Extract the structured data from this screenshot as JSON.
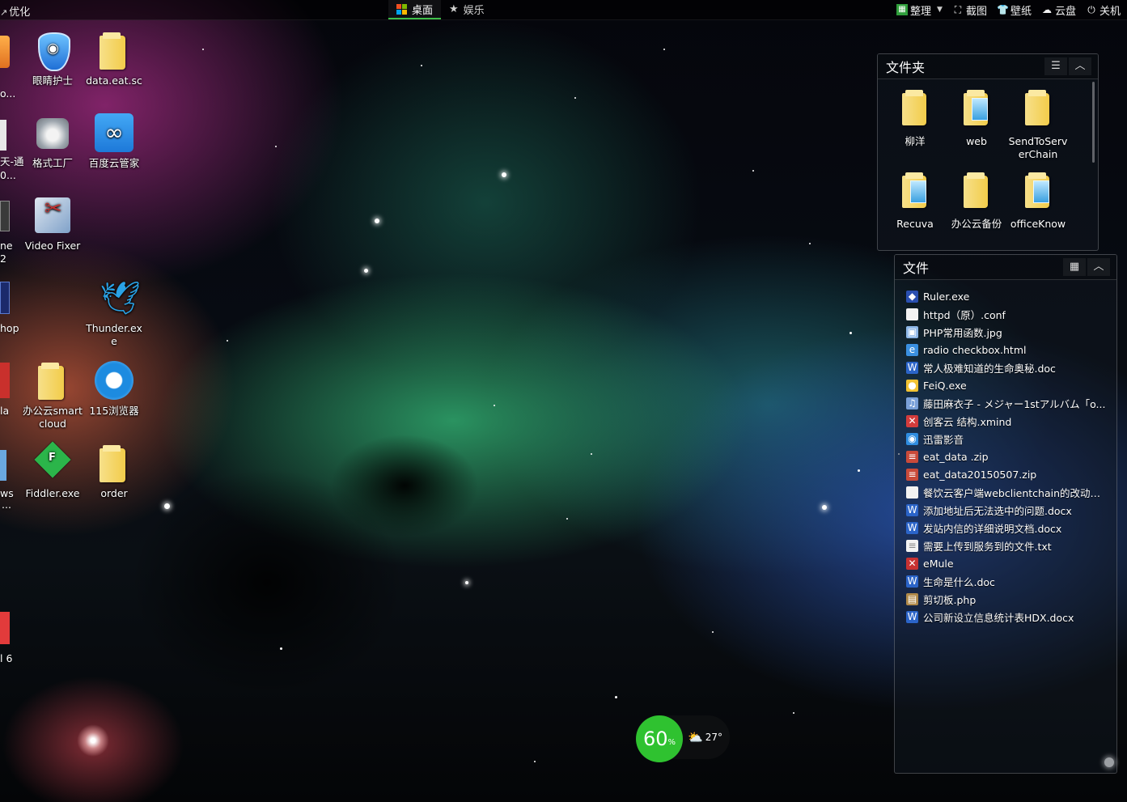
{
  "topbar": {
    "left_label": "优化",
    "tabs": [
      {
        "label": "桌面",
        "active": true,
        "icon": "windows-icon"
      },
      {
        "label": "娱乐",
        "active": false,
        "icon": "star-icon"
      }
    ],
    "tools": [
      {
        "label": "整理",
        "icon": "organize-icon",
        "has_dropdown": true
      },
      {
        "label": "截图",
        "icon": "screenshot-icon"
      },
      {
        "label": "壁纸",
        "icon": "shirt-icon"
      },
      {
        "label": "云盘",
        "icon": "cloud-icon"
      },
      {
        "label": "关机",
        "icon": "power-icon"
      }
    ]
  },
  "desktop_icons": [
    {
      "label": "眼睛护士",
      "icon": "shield-eye-icon"
    },
    {
      "label": "data.eat.sc",
      "icon": "folder-icon"
    },
    {
      "label": "格式工厂",
      "icon": "format-factory-icon"
    },
    {
      "label": "百度云管家",
      "icon": "baidu-cloud-icon"
    },
    {
      "label": "Video Fixer",
      "icon": "video-fixer-icon"
    },
    {
      "label": "Thunder.exe",
      "icon": "thunder-icon"
    },
    {
      "label": "办公云smartcloud",
      "icon": "folder-icon"
    },
    {
      "label": "115浏览器",
      "icon": "browser-115-icon"
    },
    {
      "label": "Fiddler.exe",
      "icon": "fiddler-icon"
    },
    {
      "label": "order",
      "icon": "folder-icon"
    }
  ],
  "edge_fragments": [
    "o...",
    "天-通",
    "0...",
    "ne",
    "2",
    "hop",
    "la",
    "ws",
    "...",
    "l 6"
  ],
  "folders_panel": {
    "title": "文件夹",
    "items": [
      "柳洋",
      "web",
      "SendToServerChain",
      "Recuva",
      "办公云备份",
      "officeKnow"
    ]
  },
  "files_panel": {
    "title": "文件",
    "items": [
      {
        "name": "Ruler.exe",
        "icon": "app-icon",
        "color": "#2a4fb0"
      },
      {
        "name": "httpd（原）.conf",
        "icon": "blank-file-icon",
        "color": "#f2f2f2"
      },
      {
        "name": "PHP常用函数.jpg",
        "icon": "image-file-icon",
        "color": "#8fb8e8"
      },
      {
        "name": "radio checkbox.html",
        "icon": "ie-icon",
        "color": "#3a8fe0"
      },
      {
        "name": "常人极难知道的生命奥秘.doc",
        "icon": "word-icon",
        "color": "#2b64c8"
      },
      {
        "name": "FeiQ.exe",
        "icon": "feiq-icon",
        "color": "#f1c232"
      },
      {
        "name": "藤田麻衣子 - メジャー1stアルバム「o...",
        "icon": "audio-file-icon",
        "color": "#7aa0d8"
      },
      {
        "name": "创客云 结构.xmind",
        "icon": "xmind-icon",
        "color": "#d33c3c"
      },
      {
        "name": "迅雷影音",
        "icon": "xunlei-player-icon",
        "color": "#2f8de0"
      },
      {
        "name": "eat_data .zip",
        "icon": "zip-icon",
        "color": "#c94a3a"
      },
      {
        "name": "eat_data20150507.zip",
        "icon": "zip-icon",
        "color": "#c94a3a"
      },
      {
        "name": "餐饮云客户端webclientchain的改动（...",
        "icon": "blank-file-icon",
        "color": "#f2f2f2"
      },
      {
        "name": "添加地址后无法选中的问题.docx",
        "icon": "word-icon",
        "color": "#2b64c8"
      },
      {
        "name": "发站内信的详细说明文档.docx",
        "icon": "word-icon",
        "color": "#2b64c8"
      },
      {
        "name": "需要上传到服务到的文件.txt",
        "icon": "text-file-icon",
        "color": "#f2f2f2"
      },
      {
        "name": "eMule",
        "icon": "emule-icon",
        "color": "#c83232"
      },
      {
        "name": "生命是什么.doc",
        "icon": "word-icon",
        "color": "#2b64c8"
      },
      {
        "name": "剪切板.php",
        "icon": "php-file-icon",
        "color": "#b08a4a"
      },
      {
        "name": "公司新设立信息统计表HDX.docx",
        "icon": "word-icon",
        "color": "#2b64c8"
      }
    ]
  },
  "widget": {
    "memory_value": "60",
    "memory_unit": "%",
    "temperature": "27°",
    "weather_icon": "cloud-sun-icon"
  },
  "colors": {
    "accent_green": "#2fc230",
    "tab_active_underline": "#3fc04a"
  }
}
